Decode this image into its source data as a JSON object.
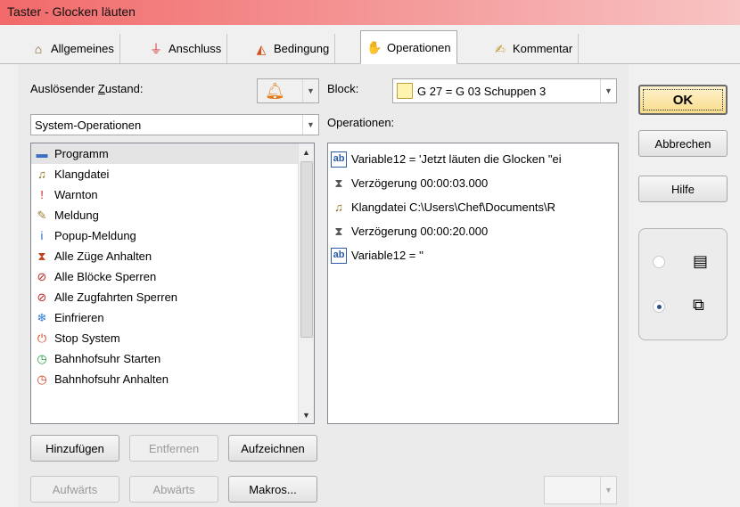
{
  "window": {
    "title": "Taster - Glocken läuten"
  },
  "tabs": [
    {
      "label": "Allgemeines",
      "icon": "house-icon"
    },
    {
      "label": "Anschluss",
      "icon": "plug-icon"
    },
    {
      "label": "Bedingung",
      "icon": "condition-icon"
    },
    {
      "label": "Operationen",
      "icon": "operations-icon",
      "active": true
    },
    {
      "label": "Kommentar",
      "icon": "comment-icon"
    }
  ],
  "left": {
    "trigger_label_pre": "Auslösender ",
    "trigger_label_key": "Z",
    "trigger_label_post": "ustand:",
    "trigger_icon": "bell-icon",
    "category": "System-Operationen",
    "items": [
      {
        "label": "Programm",
        "icon": "monitor-icon",
        "glyph": "▬",
        "color": "#3b6fc4"
      },
      {
        "label": "Klangdatei",
        "icon": "sound-file-icon",
        "glyph": "♫",
        "color": "#8a6a20"
      },
      {
        "label": "Warnton",
        "icon": "warning-tone-icon",
        "glyph": "!",
        "color": "#d42020"
      },
      {
        "label": "Meldung",
        "icon": "pencil-icon",
        "glyph": "✎",
        "color": "#9a7a30"
      },
      {
        "label": "Popup-Meldung",
        "icon": "info-icon",
        "glyph": "i",
        "color": "#2a6ad4"
      },
      {
        "label": "Alle Züge Anhalten",
        "icon": "hourglass-stop-icon",
        "glyph": "⧗",
        "color": "#c04020"
      },
      {
        "label": "Alle Blöcke Sperren",
        "icon": "block-lock-icon",
        "glyph": "⊘",
        "color": "#c02828"
      },
      {
        "label": "Alle Zugfahrten Sperren",
        "icon": "route-lock-icon",
        "glyph": "⊘",
        "color": "#c02828"
      },
      {
        "label": "Einfrieren",
        "icon": "snowflake-icon",
        "glyph": "❄",
        "color": "#2a7ad4"
      },
      {
        "label": "Stop System",
        "icon": "stop-icon",
        "glyph": "⏻",
        "color": "#d44020"
      },
      {
        "label": "Bahnhofsuhr Starten",
        "icon": "clock-icon",
        "glyph": "◷",
        "color": "#1f9a3a"
      },
      {
        "label": "Bahnhofsuhr Anhalten",
        "icon": "clock-stop-icon",
        "glyph": "◷",
        "color": "#d44020"
      }
    ],
    "buttons": {
      "add": "Hinzufügen",
      "remove": "Entfernen",
      "record": "Aufzeichnen",
      "up": "Aufwärts",
      "down": "Abwärts",
      "macros": "Makros..."
    }
  },
  "right": {
    "block_label": "Block:",
    "block_value": "G 27 = G 03   Schuppen 3",
    "operations_label": "Operationen:",
    "operations": [
      {
        "text": "Variable12 = 'Jetzt läuten die Glocken \"ei",
        "icon": "variable-icon",
        "glyph": "ab"
      },
      {
        "text": "Verzögerung 00:00:03.000",
        "icon": "hourglass-icon",
        "glyph": "⧗"
      },
      {
        "text": "Klangdatei C:\\Users\\Chef\\Documents\\R",
        "icon": "sound-file-icon",
        "glyph": "♫"
      },
      {
        "text": "Verzögerung 00:00:20.000",
        "icon": "hourglass-icon",
        "glyph": "⧗"
      },
      {
        "text": "Variable12 = ''",
        "icon": "variable-icon",
        "glyph": "ab"
      }
    ]
  },
  "dialog_buttons": {
    "ok": "OK",
    "cancel": "Abbrechen",
    "help": "Hilfe"
  },
  "view_options": {
    "selected": "details",
    "options": [
      {
        "name": "list-view",
        "icon": "list-icon"
      },
      {
        "name": "details-view",
        "icon": "details-icon"
      }
    ]
  },
  "colors": {
    "title_bar": "#f26a6a",
    "ok_button": "#f8dc8a",
    "block_swatch": "#fff3b0"
  }
}
